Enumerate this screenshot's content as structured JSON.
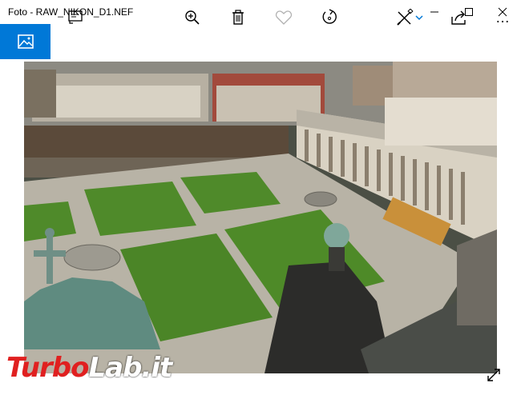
{
  "window": {
    "title": "Foto - RAW_NIKON_D1.NEF"
  },
  "titlebar_icons": [
    "minimize-icon",
    "maximize-icon",
    "close-icon"
  ],
  "toolbar": {
    "icons": [
      "photo-icon",
      "slideshow-icon",
      "zoom-in-icon",
      "delete-icon",
      "heart-icon",
      "rotate-icon",
      "edit-icon",
      "chevron-down-icon",
      "share-icon",
      "more-icon"
    ],
    "more_label": "…"
  },
  "watermark": {
    "part1": "Turbo",
    "part2": "Lab.it"
  },
  "colors": {
    "accent": "#0078d7",
    "watermark_red": "#e02020"
  }
}
